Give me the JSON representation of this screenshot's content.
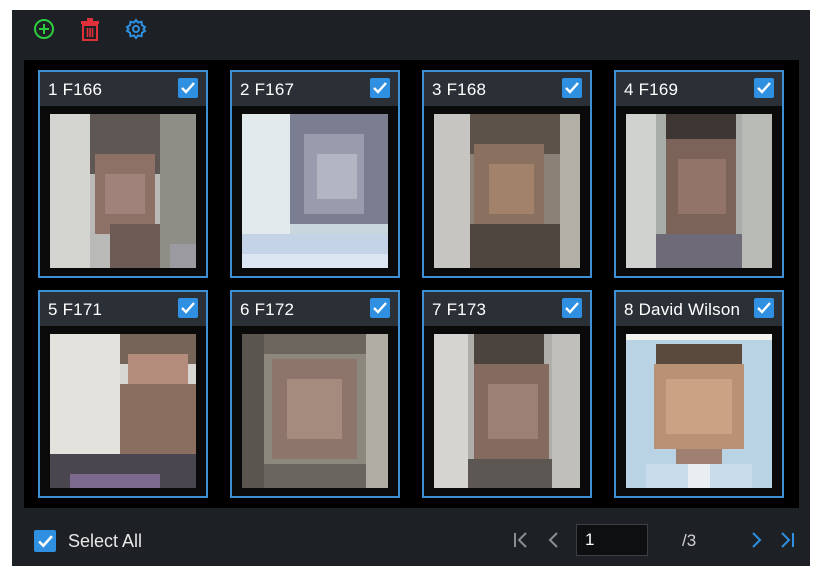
{
  "toolbar": {
    "add_icon": "plus-circle-icon",
    "delete_icon": "trash-icon",
    "settings_icon": "gear-icon",
    "colors": {
      "add": "#2ecc40",
      "delete": "#e0303a",
      "settings": "#2f8fe0"
    }
  },
  "cards": [
    {
      "label": "1  F166",
      "checked": true
    },
    {
      "label": "2  F167",
      "checked": true
    },
    {
      "label": "3  F168",
      "checked": true
    },
    {
      "label": "4  F169",
      "checked": true
    },
    {
      "label": "5  F171",
      "checked": true
    },
    {
      "label": "6  F172",
      "checked": true
    },
    {
      "label": "7  F173",
      "checked": true
    },
    {
      "label": "8  David Wilson",
      "checked": true
    }
  ],
  "footer": {
    "select_all_label": "Select All",
    "select_all_checked": true,
    "page_value": "1",
    "page_total": "/3"
  },
  "colors": {
    "accent": "#2f8fe0",
    "border": "#3d8fd6",
    "panel": "#1d2125"
  }
}
